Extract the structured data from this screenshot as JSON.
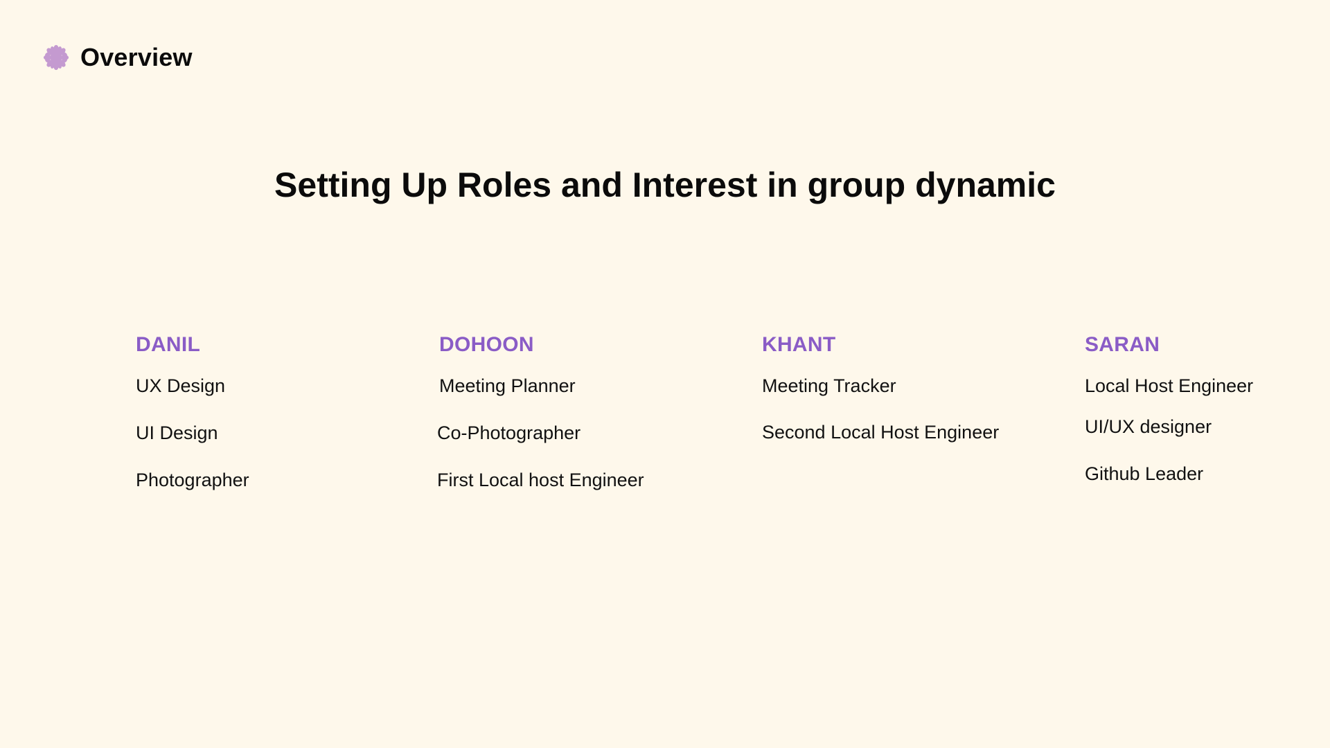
{
  "header": {
    "icon": "flower-icon",
    "label": "Overview",
    "icon_color": "#C49AD0"
  },
  "title": "Setting Up Roles and Interest in group dynamic",
  "accent_color": "#8A5CC6",
  "members": [
    {
      "name": "DANIL",
      "roles": [
        "UX Design",
        "UI Design",
        "Photographer"
      ]
    },
    {
      "name": "DOHOON",
      "roles": [
        "Meeting Planner",
        "Co-Photographer",
        "First Local host Engineer"
      ]
    },
    {
      "name": "KHANT",
      "roles": [
        "Meeting Tracker",
        "Second Local Host Engineer"
      ]
    },
    {
      "name": "SARAN",
      "roles": [
        "Local Host Engineer",
        "UI/UX designer",
        "Github Leader"
      ]
    }
  ]
}
